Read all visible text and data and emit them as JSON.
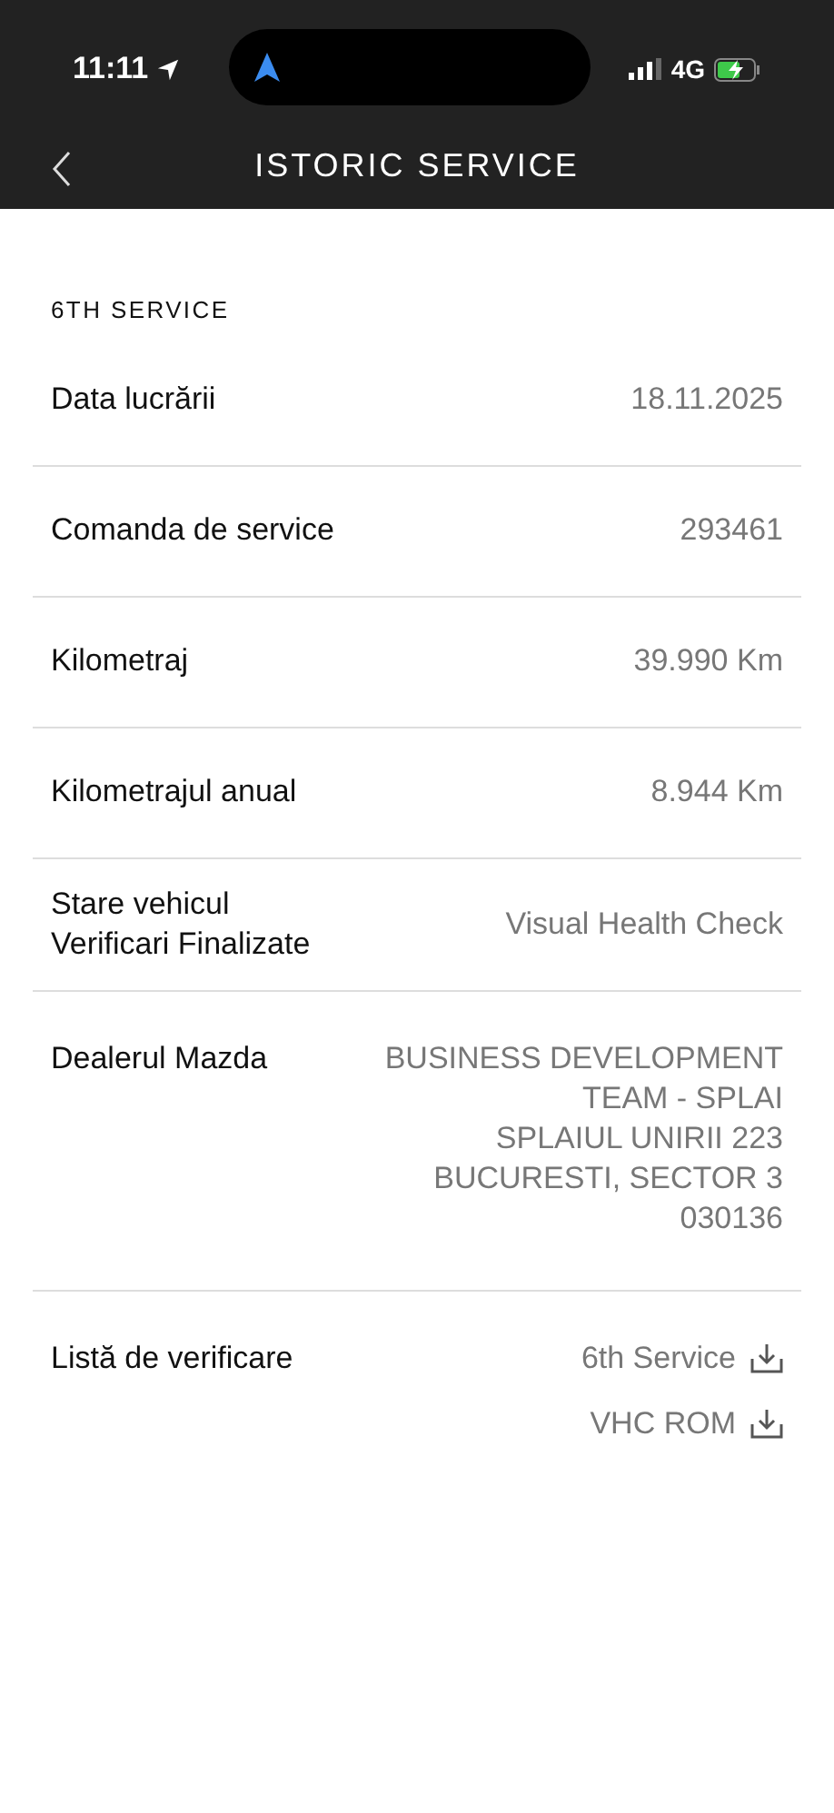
{
  "status_bar": {
    "time": "11:11",
    "network": "4G"
  },
  "header": {
    "title": "ISTORIC SERVICE"
  },
  "section_title": "6TH SERVICE",
  "rows": [
    {
      "kind": "text",
      "label": [
        "Data lucrării"
      ],
      "value": [
        "18.11.2025"
      ]
    },
    {
      "kind": "text",
      "label": [
        "Comanda de service"
      ],
      "value": [
        "293461"
      ]
    },
    {
      "kind": "text",
      "label": [
        "Kilometraj"
      ],
      "value": [
        "39.990 Km"
      ]
    },
    {
      "kind": "text",
      "label": [
        "Kilometrajul anual"
      ],
      "value": [
        "8.944 Km"
      ]
    },
    {
      "kind": "text",
      "label": [
        "Stare vehicul",
        "Verificari Finalizate"
      ],
      "value": [
        "Visual Health Check"
      ]
    },
    {
      "kind": "text",
      "label": [
        "Dealerul Mazda"
      ],
      "value": [
        "BUSINESS DEVELOPMENT",
        "TEAM - SPLAI",
        "SPLAIUL UNIRII 223",
        "BUCURESTI, SECTOR 3",
        "030136"
      ]
    },
    {
      "kind": "downloads",
      "label": [
        "Listă de verificare"
      ],
      "files": [
        "6th Service",
        "VHC ROM"
      ]
    }
  ]
}
